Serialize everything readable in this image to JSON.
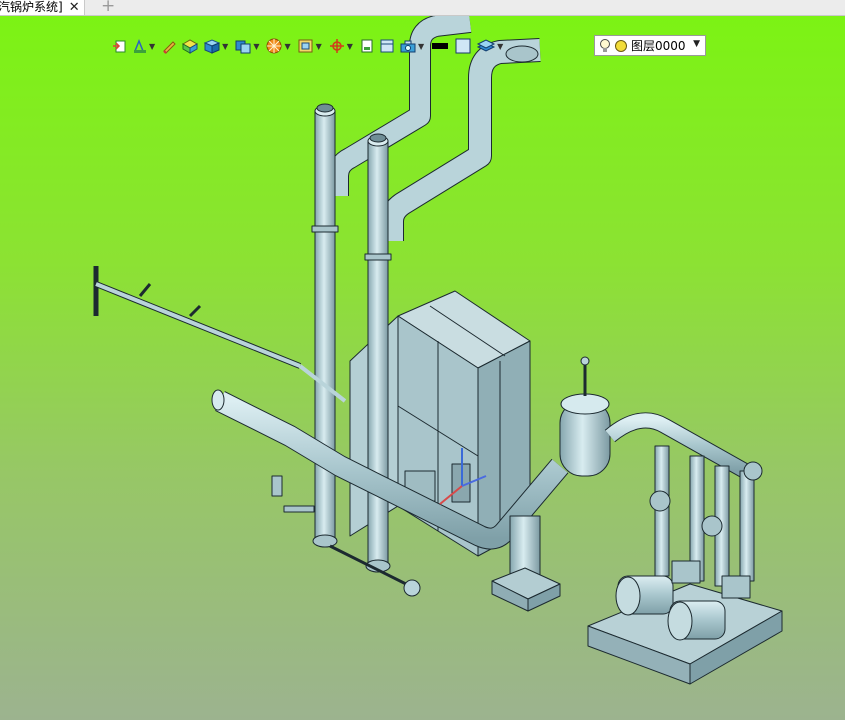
{
  "tab": {
    "label": "汽锅炉系统]",
    "close": "✕",
    "new": "+"
  },
  "layer": {
    "name": "图层0000",
    "arrow": "▼"
  },
  "toolbar": {
    "items": [
      {
        "name": "exit-sketch-icon",
        "dropdown": false
      },
      {
        "name": "measure-icon",
        "dropdown": true
      },
      {
        "name": "pencil-icon",
        "dropdown": false
      },
      {
        "name": "solid-block-icon",
        "dropdown": false
      },
      {
        "name": "cube-view-icon",
        "dropdown": true
      },
      {
        "name": "display-mode-icon",
        "dropdown": true
      },
      {
        "name": "render-style-icon",
        "dropdown": true
      },
      {
        "name": "view-orient-icon",
        "dropdown": true
      },
      {
        "name": "triad-icon",
        "dropdown": true
      },
      {
        "name": "section-icon",
        "dropdown": false
      },
      {
        "name": "filter-icon",
        "dropdown": false
      },
      {
        "name": "camera-icon",
        "dropdown": true
      },
      {
        "name": "color-black-icon",
        "dropdown": false
      },
      {
        "name": "color-light-icon",
        "dropdown": false
      },
      {
        "name": "layers-stack-icon",
        "dropdown": true
      }
    ]
  },
  "colors": {
    "background_top": "#7cf314",
    "background_bottom": "#9cb38f",
    "model_fill": "#b6d2d8",
    "model_edge": "#1c2a30"
  }
}
